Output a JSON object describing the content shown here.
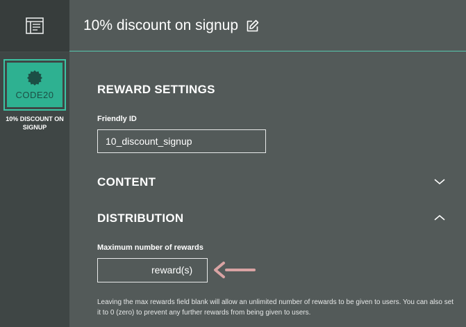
{
  "sidebar": {
    "menu_icon": "template-icon",
    "reward_card": {
      "badge_icon": "seal-badge-icon",
      "code": "CODE20",
      "caption": "10% DISCOUNT ON SIGNUP",
      "accent_color": "#2eb191",
      "border_color": "#3cc4a4"
    }
  },
  "header": {
    "title": "10% discount on signup",
    "edit_icon": "edit-icon",
    "underline_color": "#56c7ad"
  },
  "reward_settings": {
    "heading": "REWARD SETTINGS",
    "friendly_id_label": "Friendly ID",
    "friendly_id_value": "10_discount_signup"
  },
  "content_section": {
    "heading": "CONTENT",
    "expanded": false,
    "toggle_icon": "chevron-down-icon"
  },
  "distribution_section": {
    "heading": "DISTRIBUTION",
    "expanded": true,
    "toggle_icon": "chevron-up-icon",
    "max_rewards_label": "Maximum number of rewards",
    "max_rewards_value": "",
    "max_rewards_suffix": "reward(s)",
    "pointer_arrow_icon": "left-arrow-icon",
    "pointer_arrow_color": "#d9a3a3",
    "help_text": "Leaving the max rewards field blank will allow an unlimited number of rewards to be given to users. You can also set it to 0 (zero) to prevent any further rewards from being given to users."
  }
}
